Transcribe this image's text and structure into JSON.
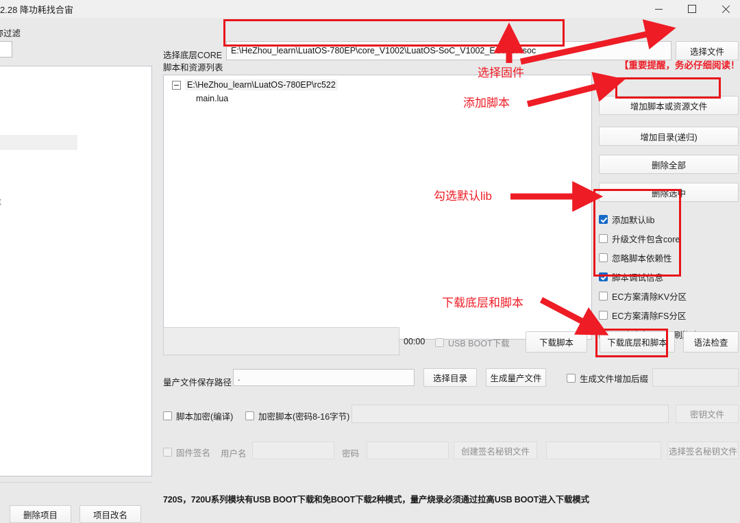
{
  "window": {
    "title": "2.28 降功耗找合宙",
    "minimize_label": "minimize",
    "maximize_label": "maximize",
    "close_label": "close"
  },
  "left_panel": {
    "filter_label": "名称过滤",
    "filter_value": "",
    "list_text": "数量",
    "delete_project_button": "删除项目",
    "rename_project_button": "项目改名"
  },
  "main": {
    "core_label": "选择底层CORE",
    "core_path": "E:\\HeZhou_learn\\LuatOS-780EP\\core_V1002\\LuatOS-SoC_V1002_EC718P.soc",
    "choose_file_button": "选择文件",
    "script_list_label": "脚本和资源列表",
    "tree": {
      "root": "E:\\HeZhou_learn\\LuatOS-780EP\\rc522",
      "children": [
        "main.lua"
      ]
    },
    "side_buttons": [
      "增加脚本或资源文件",
      "增加目录(递归)",
      "删除全部",
      "删除选中"
    ],
    "checkboxes": [
      {
        "label": "添加默认lib",
        "checked": true,
        "disabled": false
      },
      {
        "label": "升级文件包含core",
        "checked": false,
        "disabled": false
      },
      {
        "label": "忽略脚本依赖性",
        "checked": false,
        "disabled": false
      },
      {
        "label": "脚本调试信息",
        "checked": true,
        "disabled": false
      },
      {
        "label": "EC方案清除KV分区",
        "checked": false,
        "disabled": false
      },
      {
        "label": "EC方案清除FS分区",
        "checked": false,
        "disabled": false
      },
      {
        "label": "EC方案免BOOT刷脚本",
        "checked": false,
        "disabled": false
      }
    ],
    "timer": "00:00",
    "usb_boot_label": "USB BOOT下载",
    "usb_boot_checked": false,
    "download_script_button": "下载脚本",
    "download_core_script_button": "下载底层和脚本",
    "syntax_check_button": "语法检查",
    "mass_label": "量产文件保存路径",
    "mass_path": ".",
    "choose_dir_button": "选择目录",
    "generate_mass_button": "生成量产文件",
    "mass_suffix_label": "生成文件增加后缀",
    "mass_suffix_checked": false,
    "mass_suffix_value": "",
    "encrypt_compile_label": "脚本加密(编译)",
    "encrypt_compile_checked": false,
    "encrypt_script_label": "加密脚本(密码8-16字节)",
    "encrypt_script_checked": false,
    "encrypt_value": "",
    "key_file_button": "密钥文件",
    "firmware_sign_label": "固件签名",
    "firmware_sign_checked": false,
    "username_label": "用户名",
    "username_value": "",
    "password_label": "密码",
    "password_value": "",
    "create_sign_key_button": "创建签名秘钥文件",
    "sign_key_value": "",
    "choose_sign_key_button": "选择签名秘钥文件",
    "footer_note": "720S，720U系列模块有USB BOOT下载和免BOOT下载2种模式，量产烧录必须通过拉高USB BOOT进入下载模式"
  },
  "annotations": {
    "select_firmware": "选择固件",
    "add_script": "添加脚本",
    "check_default_lib": "勾选默认lib",
    "download_core_and_script": "下载底层和脚本",
    "important_warning": "【重要提醒，务必仔细阅读！】",
    "color": "#ee1c25"
  }
}
